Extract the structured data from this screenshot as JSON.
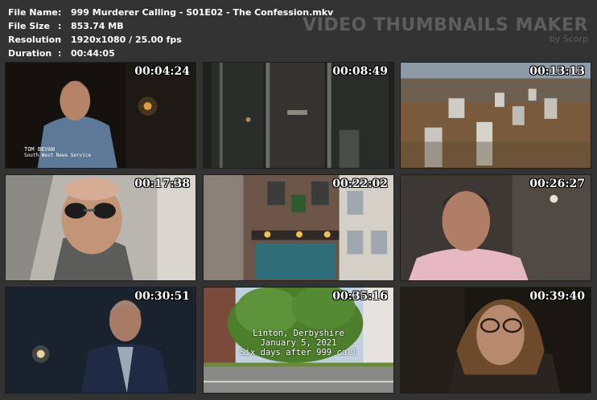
{
  "file_info": [
    {
      "label": "File Name",
      "sep": ":",
      "value": "999 Murderer Calling - S01E02 - The Confession.mkv"
    },
    {
      "label": "File Size",
      "sep": ":",
      "value": "853.74 MB"
    },
    {
      "label": "Resolution",
      "sep": ":",
      "value": "1920x1080 / 25.00 fps"
    },
    {
      "label": "Duration",
      "sep": ":",
      "value": "00:44:05"
    }
  ],
  "brand": {
    "title": "VIDEO THUMBNAILS MAKER",
    "subtitle": "by Scorp"
  },
  "thumbnails": [
    {
      "timestamp": "00:04:24",
      "scene": "man-interview-dark",
      "lower_third": {
        "name": "TOM BEVAN",
        "role": "South West News Service"
      }
    },
    {
      "timestamp": "00:08:49",
      "scene": "glass-doors"
    },
    {
      "timestamp": "00:13:13",
      "scene": "aerial-city"
    },
    {
      "timestamp": "00:17:38",
      "scene": "man-sunglasses-car"
    },
    {
      "timestamp": "00:22:02",
      "scene": "pub-exterior"
    },
    {
      "timestamp": "00:26:27",
      "scene": "man-interview-pink-shirt"
    },
    {
      "timestamp": "00:30:51",
      "scene": "man-interview-suit"
    },
    {
      "timestamp": "00:35:16",
      "scene": "tree-street",
      "caption": [
        "Linton, Derbyshire",
        "January 5, 2021",
        "Six days after 999 call"
      ]
    },
    {
      "timestamp": "00:39:40",
      "scene": "woman-glasses"
    }
  ],
  "colors": {
    "background": "#333333",
    "text": "#ffffff",
    "brand": "#5d5d5d"
  }
}
